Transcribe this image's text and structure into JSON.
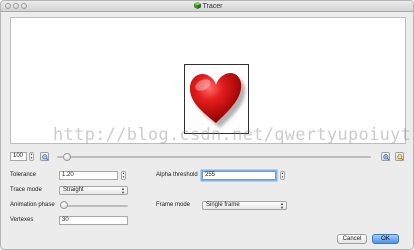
{
  "window": {
    "title": "Tracer"
  },
  "preview": {
    "image_name": "red-heart-image"
  },
  "watermark": "http://blog.csdn.net/qwertyupoiuytr",
  "zoom": {
    "value": "100",
    "slider_fraction": 0.02
  },
  "form": {
    "tolerance_label": "Tolerance",
    "tolerance_value": "1.20",
    "trace_mode_label": "Trace mode",
    "trace_mode_value": "Straight",
    "animation_phase_label": "Animation phase",
    "animation_phase_fraction": 0.0,
    "vertexes_label": "Vertexes",
    "vertexes_value": "30",
    "alpha_threshold_label": "Alpha threshold",
    "alpha_threshold_value": "255",
    "frame_mode_label": "Frame mode",
    "frame_mode_value": "Single frame"
  },
  "buttons": {
    "cancel": "Cancel",
    "ok": "OK"
  },
  "icons": {
    "zoom_out": "zoom-out-icon",
    "zoom_in": "zoom-in-icon",
    "zoom_fit": "zoom-fit-icon",
    "app": "tracer-app-icon"
  },
  "colors": {
    "accent": "#4a94e6",
    "heart": "#d61414"
  }
}
